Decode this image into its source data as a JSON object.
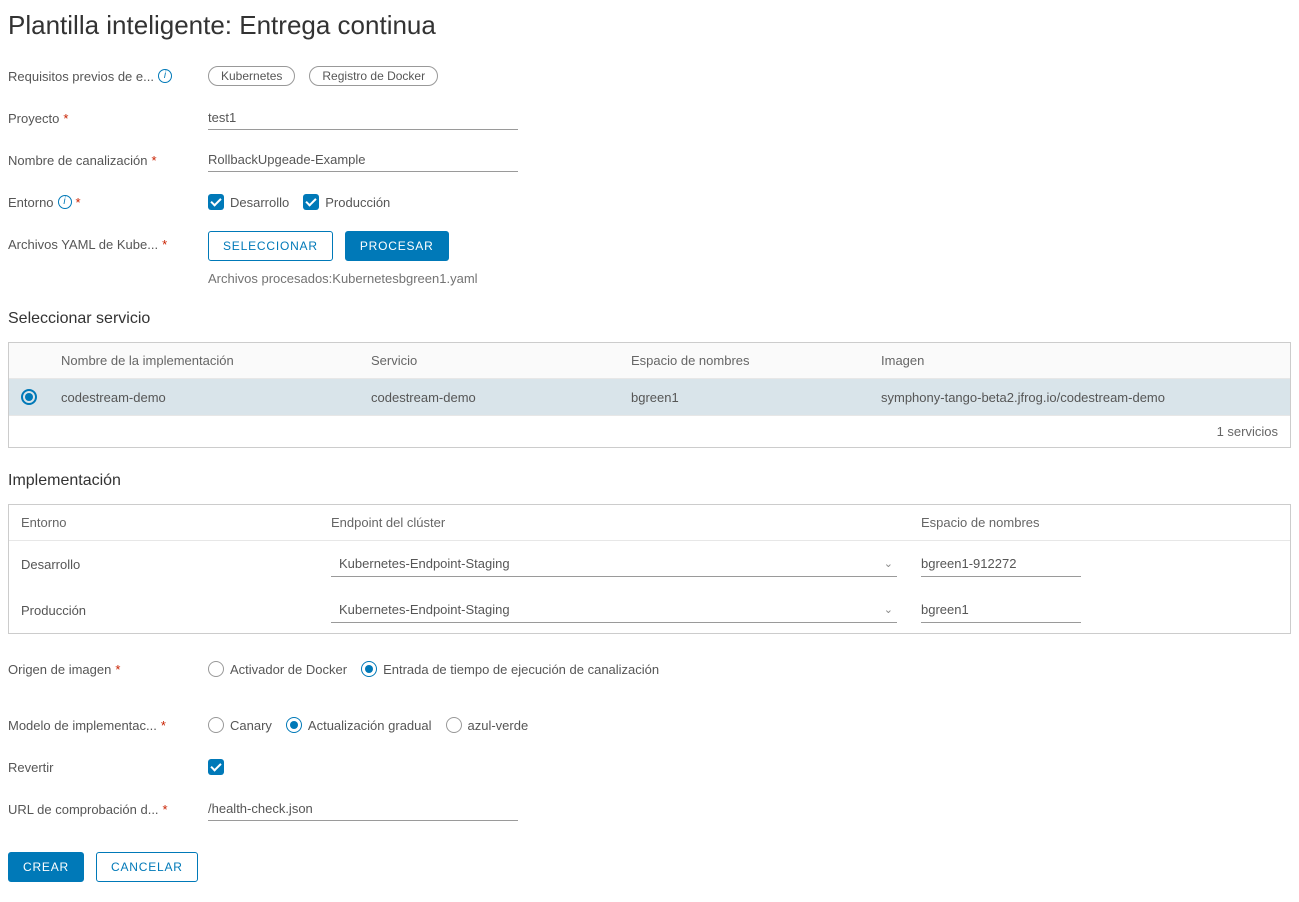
{
  "title": "Plantilla inteligente: Entrega continua",
  "labels": {
    "prereq": "Requisitos previos de e...",
    "project": "Proyecto",
    "pipeline": "Nombre de canalización",
    "env": "Entorno",
    "yaml": "Archivos YAML de Kube...",
    "selectService": "Seleccionar servicio",
    "impl": "Implementación",
    "imgOrigin": "Origen de imagen",
    "deployModel": "Modelo de implementac...",
    "revert": "Revertir",
    "healthUrl": "URL de comprobación d..."
  },
  "chips": {
    "k8s": "Kubernetes",
    "docker": "Registro de Docker"
  },
  "fields": {
    "project": "test1",
    "pipeline": "RollbackUpgeade-Example",
    "healthUrl": "/health-check.json"
  },
  "envOptions": {
    "dev": "Desarrollo",
    "prod": "Producción"
  },
  "buttons": {
    "select": "SELECCIONAR",
    "process": "PROCESAR",
    "create": "CREAR",
    "cancel": "CANCELAR"
  },
  "hintProcessed": "Archivos procesados:Kubernetesbgreen1.yaml",
  "serviceTable": {
    "headers": {
      "name": "Nombre de la implementación",
      "svc": "Servicio",
      "ns": "Espacio de nombres",
      "img": "Imagen"
    },
    "row": {
      "name": "codestream-demo",
      "svc": "codestream-demo",
      "ns": "bgreen1",
      "img": "symphony-tango-beta2.jfrog.io/codestream-demo"
    },
    "footer": "1 servicios"
  },
  "implTable": {
    "headers": {
      "env": "Entorno",
      "ep": "Endpoint del clúster",
      "ns": "Espacio de nombres"
    },
    "rows": [
      {
        "env": "Desarrollo",
        "ep": "Kubernetes-Endpoint-Staging",
        "ns": "bgreen1-912272"
      },
      {
        "env": "Producción",
        "ep": "Kubernetes-Endpoint-Staging",
        "ns": "bgreen1"
      }
    ]
  },
  "imgOrigin": {
    "docker": "Activador de Docker",
    "runtime": "Entrada de tiempo de ejecución de canalización"
  },
  "deployModel": {
    "canary": "Canary",
    "rolling": "Actualización gradual",
    "bluegreen": "azul-verde"
  }
}
